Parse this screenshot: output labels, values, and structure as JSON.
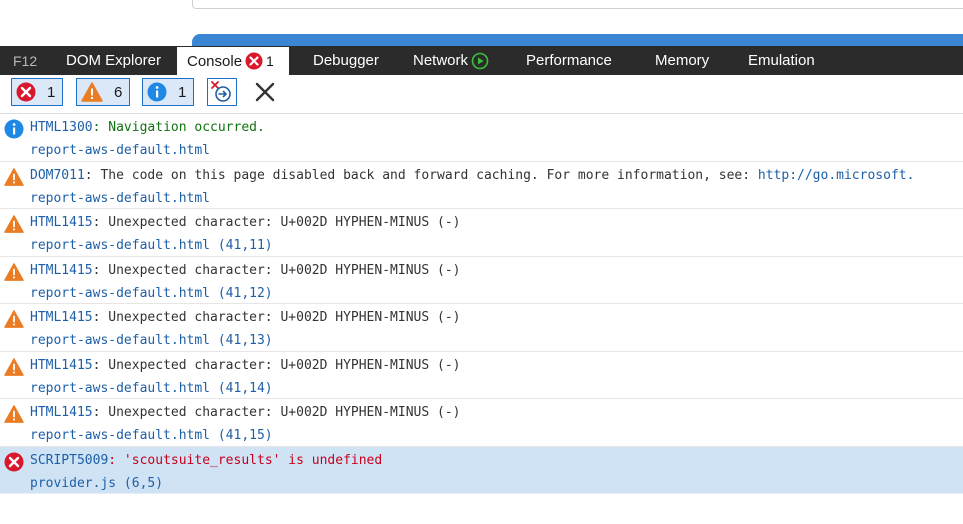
{
  "tabs": [
    {
      "label": "F12"
    },
    {
      "label": "DOM Explorer"
    },
    {
      "label": "Console",
      "count": "1"
    },
    {
      "label": "Debugger"
    },
    {
      "label": "Network"
    },
    {
      "label": "Performance"
    },
    {
      "label": "Memory"
    },
    {
      "label": "Emulation"
    }
  ],
  "toolbar": {
    "errors_count": "1",
    "warnings_count": "6",
    "info_count": "1"
  },
  "messages": [
    {
      "type": "info",
      "code": "HTML1300",
      "text": ": Navigation occurred.",
      "source": "report-aws-default.html"
    },
    {
      "type": "warning",
      "code": "DOM7011",
      "text": ": The code on this page disabled back and forward caching. For more information, see: ",
      "link": "http://go.microsoft.",
      "source": "report-aws-default.html"
    },
    {
      "type": "warning",
      "code": "HTML1415",
      "text": ": Unexpected character: U+002D HYPHEN-MINUS (-)",
      "source": "report-aws-default.html (41,11)"
    },
    {
      "type": "warning",
      "code": "HTML1415",
      "text": ": Unexpected character: U+002D HYPHEN-MINUS (-)",
      "source": "report-aws-default.html (41,12)"
    },
    {
      "type": "warning",
      "code": "HTML1415",
      "text": ": Unexpected character: U+002D HYPHEN-MINUS (-)",
      "source": "report-aws-default.html (41,13)"
    },
    {
      "type": "warning",
      "code": "HTML1415",
      "text": ": Unexpected character: U+002D HYPHEN-MINUS (-)",
      "source": "report-aws-default.html (41,14)"
    },
    {
      "type": "warning",
      "code": "HTML1415",
      "text": ": Unexpected character: U+002D HYPHEN-MINUS (-)",
      "source": "report-aws-default.html (41,15)"
    },
    {
      "type": "error",
      "code": "SCRIPT5009",
      "text": ": 'scoutsuite_results' is undefined",
      "source": "provider.js (6,5)"
    }
  ],
  "icons": {
    "error": "error-icon",
    "warning": "warning-icon",
    "info": "info-icon",
    "network_record": "record-icon",
    "clear_on_navigate": "clear-on-navigate-icon",
    "clear": "close-icon"
  },
  "colors": {
    "tabbar_bg": "#2b2b2b",
    "error_red": "#d9182d",
    "warning_orange": "#ea7d24",
    "info_blue": "#1e88e5",
    "error_row_bg": "#cfe3f4",
    "info_text": "#127212",
    "error_text": "#c8001e",
    "link_blue": "#1e5fa8"
  }
}
